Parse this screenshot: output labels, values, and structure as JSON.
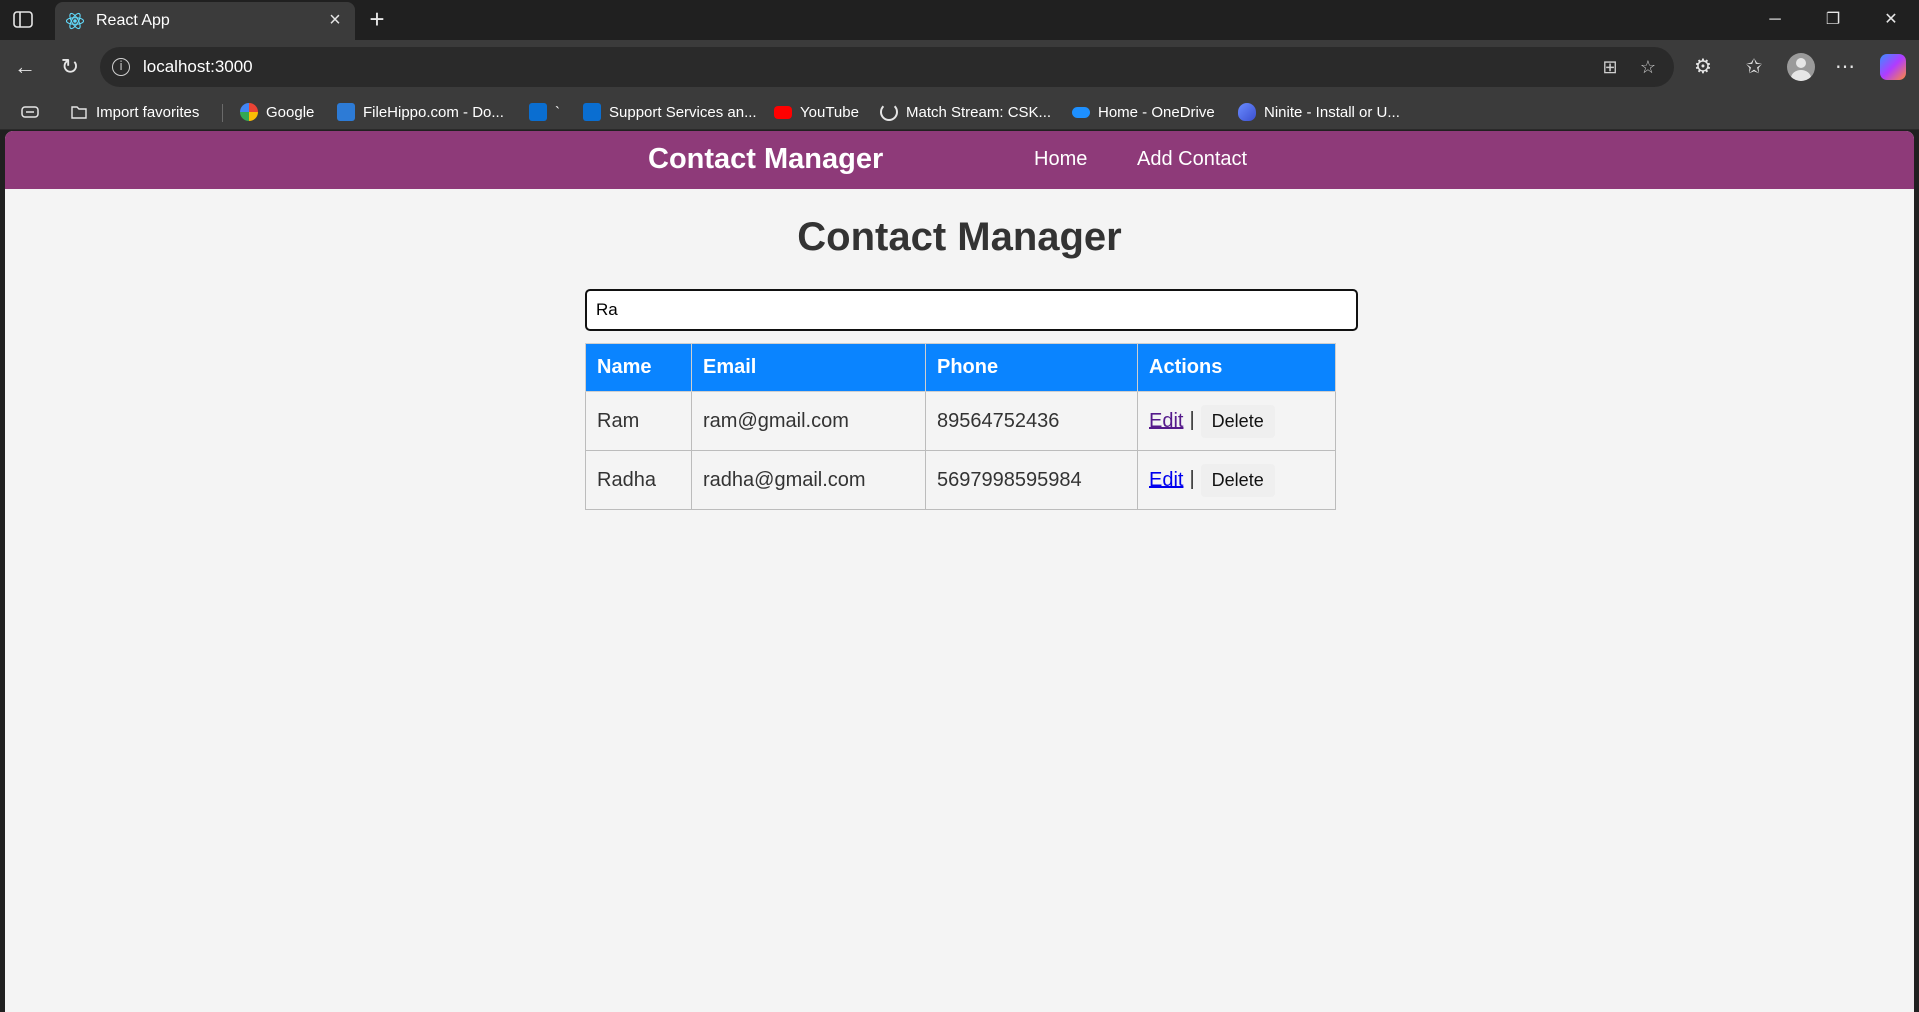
{
  "browser": {
    "tab_title": "React App",
    "url": "localhost:3000",
    "bookmarks": [
      {
        "label": "Import favorites",
        "icon": "folder-icon"
      },
      {
        "label": "Google",
        "icon": "google-icon"
      },
      {
        "label": "FileHippo.com - Do...",
        "icon": "filehippo-icon"
      },
      {
        "label": "`",
        "icon": "dell-icon"
      },
      {
        "label": "Support Services an...",
        "icon": "dell-icon"
      },
      {
        "label": "YouTube",
        "icon": "youtube-icon"
      },
      {
        "label": "Match Stream: CSK...",
        "icon": "loading-icon"
      },
      {
        "label": "Home - OneDrive",
        "icon": "onedrive-icon"
      },
      {
        "label": "Ninite - Install or U...",
        "icon": "ninite-icon"
      }
    ]
  },
  "app": {
    "brand": "Contact Manager",
    "nav": {
      "home": "Home",
      "add_contact": "Add Contact"
    },
    "title": "Contact Manager",
    "search_value": "Ra",
    "table": {
      "headers": {
        "name": "Name",
        "email": "Email",
        "phone": "Phone",
        "actions": "Actions"
      },
      "rows": [
        {
          "name": "Ram",
          "email": "ram@gmail.com",
          "phone": "89564752436",
          "edit": "Edit",
          "delete": "Delete"
        },
        {
          "name": "Radha",
          "email": "radha@gmail.com",
          "phone": "5697998595984",
          "edit": "Edit",
          "delete": "Delete"
        }
      ],
      "separator": "|"
    }
  },
  "colors": {
    "navbar": "#8e3a79",
    "table_header": "#0a84ff",
    "page_bg": "#f4f4f4"
  }
}
